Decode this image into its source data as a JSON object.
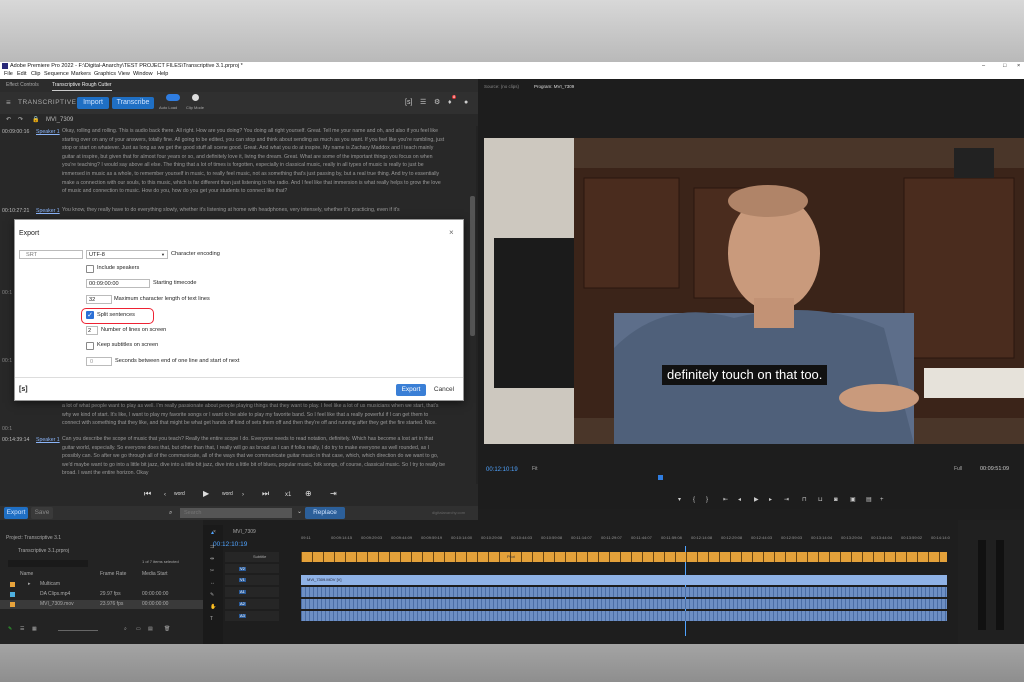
{
  "window": {
    "title": "Adobe Premiere Pro 2022 - F:\\Digital-Anarchy\\TEST PROJECT FILES\\Transcriptive 3.1.prproj *",
    "controls": [
      "–",
      "□",
      "×"
    ]
  },
  "menu": [
    "File",
    "Edit",
    "Clip",
    "Sequence",
    "Markers",
    "Graphics",
    "View",
    "Window",
    "Help"
  ],
  "left_tabs": [
    "Effect Controls",
    "Transcriptive Rough Cutter"
  ],
  "plugin": {
    "brand": "TRANSCRIPTIVE",
    "import_label": "Import",
    "transcribe_label": "Transcribe",
    "autoload_label": "Auto Load",
    "clipmode_label": "Clip Mode",
    "badge": "8"
  },
  "clip_name": "MVI_7309",
  "transcript": [
    {
      "time": "00:09:00:16",
      "speaker": "Speaker 1",
      "text": "Okay, rolling and rolling. This is audio back there. All right. How are you doing? You doing all right yourself. Great. Tell me your name and oh, and also if you feel like starting over on any of your answers, totally fine. All going to be edited, you can stop and think about sending as much as you want. If you feel like you're rambling, just stop or start on whatever. Just as long as we get the good stuff all scene good. Great. And what you do at inspire. My name is Zachary Maddox and I teach mainly guitar at inspire, but given that for almost four years or so, and definitely love it, living the dream. Great. What are some of the important things you focus on when you're teaching? I would say above all else. The thing that a lot of times is forgotten, especially in classical music, really in all types of music is really to just be immersed in music as a whole, to remember yourself in music, to really feel music, not as something that's just passing by, but a real true thing. And try to essentially make a connection with our souls, to this music, which is far different than just listening to the radio. And I feel like that immersion is what really helps to grow the love of music and connection to music. How do you, how do you get your students to connect like that?"
    },
    {
      "time": "00:10:27:21",
      "speaker": "Speaker 1",
      "text": "You know, they really have to do everything slowly, whether it's listening at home with headphones, very intensely, whether it's practicing, even if it's"
    },
    {
      "time": "00:14:39:14",
      "speaker": "Speaker 1",
      "text": "Can you describe the scope of music that you teach? Really the entire scope I do. Everyone needs to read notation, definitely. Which has become a lost art in that guitar world, especially. So everyone does that, but other than that, I really will go as broad as I can if folks really, I do try to make everyone as well rounded, as I possibly can. So after we go through all of the communicate, all of the ways that we communicate guitar music in that case, which, which direction do we want to go, we'd maybe want to go into a little bit jazz, dive into a little bit jazz, dive into a little bit of blues, popular music, folk songs, of course, classical music. So I try to really be broad. I want the entire horizon. Okay"
    }
  ],
  "mid_para": "a lot of what people want to play as well. I'm really passionate about people playing things that they want to play. I feel like a lot of us musicians when we start, that's why we kind of start. It's like, I want to play my favorite songs or I want to be able to play my favorite band. So I feel like that a really powerful if I can get them to connect with something that they like, and that might be what get hands off kind of sets them off and then they're off and running after they get the fire started. Nice.",
  "side_times": [
    "00:1",
    "00:1",
    "00:1"
  ],
  "play_controls": [
    "word",
    "word",
    "x1"
  ],
  "search": {
    "export_label": "Export",
    "save_label": "Save",
    "placeholder": "Search",
    "replace_label": "Replace",
    "powered": "digitalanarchy.com"
  },
  "dialog": {
    "title": "Export",
    "close": "×",
    "format": "SRT",
    "encoding": "UTF-8",
    "encoding_label": "Character encoding",
    "include_speakers": "Include speakers",
    "timecode": "00:09:00:00",
    "timecode_label": "Starting timecode",
    "maxlen": "32",
    "maxlen_label": "Maximum character length of text lines",
    "split_label": "Split sentences",
    "lines": "2",
    "lines_label": "Number of lines on screen",
    "keep_label": "Keep subtitles on screen",
    "gap": "0",
    "gap_label": "Seconds between end of one line and start of next",
    "logo": "[s]",
    "export_btn": "Export",
    "cancel_btn": "Cancel"
  },
  "monitor": {
    "source_tab": "Source: (no clips)",
    "program_tab": "Program: MVI_7309",
    "timecode": "00:12:10:19",
    "fit": "Fit",
    "full": "Full",
    "duration": "00:09:51:09",
    "caption": "definitely touch on that too."
  },
  "project": {
    "tab": "Project: Transcriptive 3.1",
    "file": "Transcriptive 3.1.prproj",
    "count": "1 of 7 items selected",
    "cols": [
      "Name",
      "Frame Rate",
      "Media Start"
    ],
    "items": [
      {
        "name": "Multicam",
        "rate": "",
        "start": "",
        "color": "#e8a33c"
      },
      {
        "name": "DA Clips.mp4",
        "rate": "29.97 fps",
        "start": "00:00:00:00",
        "color": "#4fb0e0"
      },
      {
        "name": "MVI_7309.mov",
        "rate": "23.976 fps",
        "start": "00:00:00:00",
        "color": "#e8a33c"
      }
    ]
  },
  "timeline": {
    "tab": "MVI_7309",
    "timecode": "00:12:10:19",
    "ruler": [
      "09:11",
      "00:09:14:15",
      "00:09:29:03",
      "00:09:44:09",
      "00:09:59:19",
      "00:10:14:00",
      "00:10:29:08",
      "00:10:44:03",
      "00:10:59:08",
      "00:11:14:07",
      "00:11:29:07",
      "00:11:44:07",
      "00:11:59:08",
      "00:12:14:08",
      "00:12:29:08",
      "00:12:44:03",
      "00:12:59:03",
      "00:13:14:04",
      "00:13:29:04",
      "00:13:44:04",
      "00:13:59:02",
      "00:14:14:0"
    ],
    "tracks": [
      "V2",
      "V1",
      "A1",
      "A2",
      "A3"
    ],
    "subtitle_label": "Subtitle",
    "clip_label": "MVI_7309.MOV [V]",
    "caption_chip": "Pilot"
  }
}
